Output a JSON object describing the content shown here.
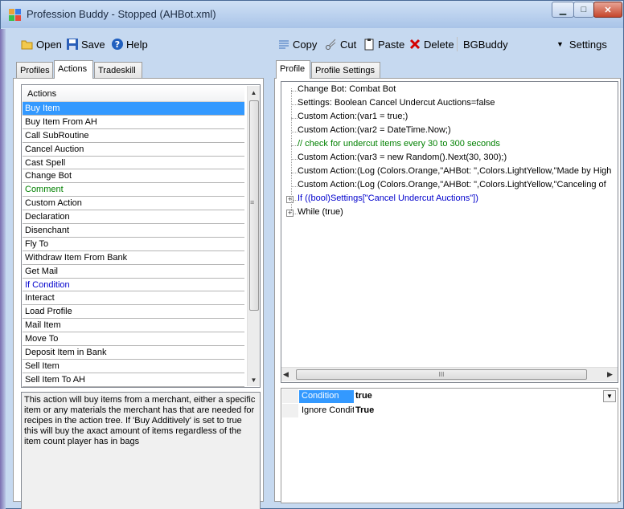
{
  "window": {
    "title": "Profession Buddy - Stopped (AHBot.xml)",
    "controls": {
      "minimize": "▁",
      "maximize": "□",
      "close": "✕"
    }
  },
  "left_toolbar": {
    "open_label": "Open",
    "save_label": "Save",
    "help_label": "Help"
  },
  "right_toolbar": {
    "copy_label": "Copy",
    "cut_label": "Cut",
    "paste_label": "Paste",
    "delete_label": "Delete",
    "bot_select": "BGBuddy",
    "settings_label": "Settings"
  },
  "left_tabs": [
    "Profiles",
    "Actions",
    "Tradeskill"
  ],
  "right_tabs": [
    "Profile",
    "Profile Settings"
  ],
  "actions_list": {
    "header": "Actions",
    "items": [
      "Buy Item",
      "Buy Item From AH",
      "Call SubRoutine",
      "Cancel Auction",
      "Cast Spell",
      "Change Bot",
      "Comment",
      "Custom Action",
      "Declaration",
      "Disenchant",
      "Fly To",
      "Withdraw Item From Bank",
      "Get Mail",
      "If Condition",
      "Interact",
      "Load Profile",
      "Mail Item",
      "Move To",
      "Deposit Item in Bank",
      "Sell Item",
      "Sell Item To AH"
    ]
  },
  "description": "This action will buy items from a merchant, either a specific item or any materials the merchant has that are needed for recipes in the action tree. If 'Buy Additively' is set to true this will buy the axact amount of items regardless of the item count player has in bags",
  "tree": {
    "items": [
      "Change Bot: Combat Bot",
      "Settings: Boolean Cancel Undercut Auctions=false",
      "Custom Action:(var1 = true;)",
      "Custom Action:(var2 = DateTime.Now;)",
      "// check for undercut items every 30 to 300 seconds",
      "Custom Action:(var3 = new Random().Next(30, 300);)",
      "Custom Action:(Log (Colors.Orange,\"AHBot: \",Colors.LightYellow,\"Made by High",
      "Custom Action:(Log (Colors.Orange,\"AHBot: \",Colors.LightYellow,\"Canceling of",
      "If ((bool)Settings[\"Cancel Undercut Auctions\"])",
      "While (true)"
    ],
    "comment_color": "#008000",
    "if_color": "#0000cc"
  },
  "property_grid": {
    "rows": [
      {
        "name": "Condition",
        "value": "true"
      },
      {
        "name": "Ignore Condit",
        "value": "True"
      }
    ]
  },
  "hscroll_grip": "III"
}
